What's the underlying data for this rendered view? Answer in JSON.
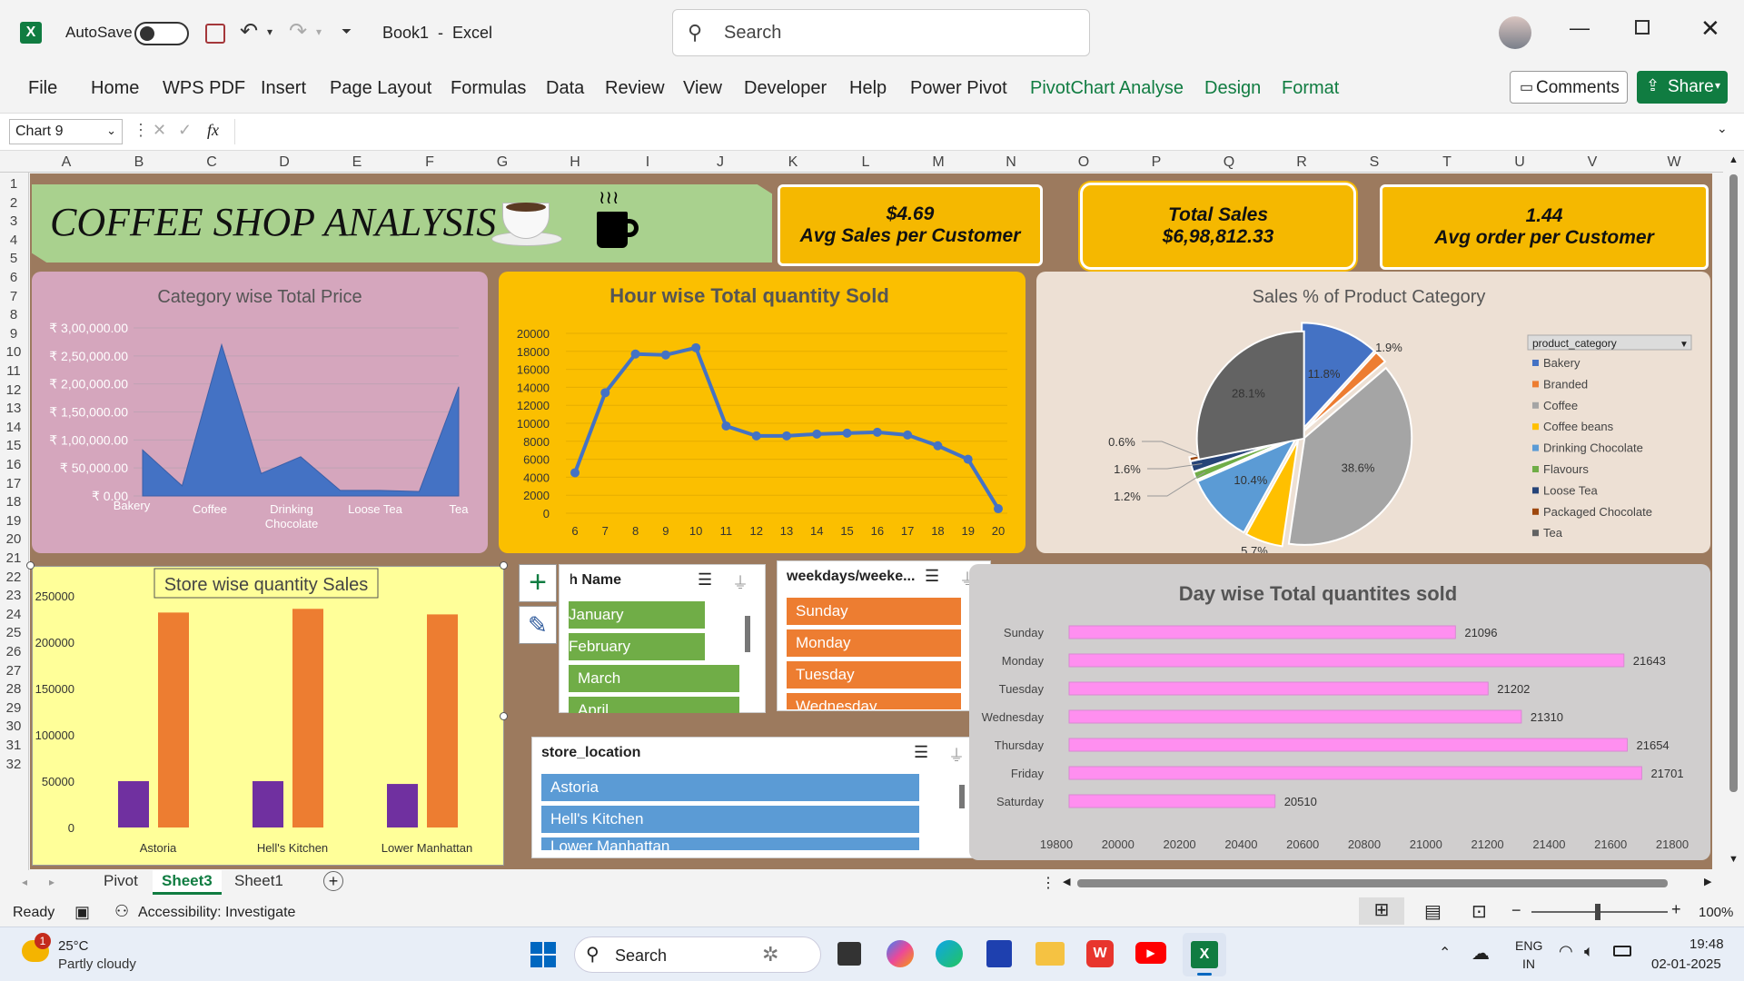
{
  "titlebar": {
    "autosave_label": "AutoSave",
    "doc_title": "Book1  -  Excel",
    "search_placeholder": "Search"
  },
  "ribbon": {
    "tabs": [
      "File",
      "Home",
      "WPS PDF",
      "Insert",
      "Page Layout",
      "Formulas",
      "Data",
      "Review",
      "View",
      "Developer",
      "Help",
      "Power Pivot",
      "PivotChart Analyse",
      "Design",
      "Format"
    ],
    "comments_label": "Comments",
    "share_label": "Share"
  },
  "formula_bar": {
    "name_box": "Chart 9",
    "fx": "fx"
  },
  "columns": [
    "A",
    "B",
    "C",
    "D",
    "E",
    "F",
    "G",
    "H",
    "I",
    "J",
    "K",
    "L",
    "M",
    "N",
    "O",
    "P",
    "Q",
    "R",
    "S",
    "T",
    "U",
    "V",
    "W"
  ],
  "rows": [
    "1",
    "2",
    "3",
    "4",
    "5",
    "6",
    "7",
    "8",
    "9",
    "10",
    "11",
    "12",
    "13",
    "14",
    "15",
    "16",
    "17",
    "18",
    "19",
    "20",
    "21",
    "22",
    "23",
    "24",
    "25",
    "26",
    "27",
    "28",
    "29",
    "30",
    "31",
    "32"
  ],
  "dashboard": {
    "title": "COFFEE SHOP ANALYSIS",
    "kpis": [
      {
        "value": "$4.69",
        "label": "Avg Sales per Customer"
      },
      {
        "value": "Total Sales",
        "label": "$6,98,812.33"
      },
      {
        "value": "1.44",
        "label": "Avg order per Customer"
      }
    ]
  },
  "chart_data": [
    {
      "type": "area",
      "title": "Category wise Total Price",
      "categories": [
        "Bakery",
        "Coffee",
        "Drinking Chocolate",
        "Loose Tea",
        "Tea"
      ],
      "x_tick_labels": [
        "Bakery",
        "Coffee",
        "Drinking",
        "Chocolate",
        "Loose Tea",
        "Tea"
      ],
      "values": [
        82000,
        18000,
        270000,
        40000,
        70000,
        10000,
        10000,
        8000,
        195000
      ],
      "ylim": [
        0,
        300000
      ],
      "y_ticks": [
        "₹ 0.00",
        "₹ 50,000.00",
        "₹ 1,00,000.00",
        "₹ 1,50,000.00",
        "₹ 2,00,000.00",
        "₹ 2,50,000.00",
        "₹ 3,00,000.00"
      ],
      "color": "#4472c4"
    },
    {
      "type": "line",
      "title": "Hour wise Total quantity Sold",
      "x": [
        6,
        7,
        8,
        9,
        10,
        11,
        12,
        13,
        14,
        15,
        16,
        17,
        18,
        19,
        20
      ],
      "values": [
        4500,
        13400,
        17700,
        17600,
        18400,
        9700,
        8600,
        8600,
        8800,
        8900,
        9000,
        8700,
        7500,
        6000,
        500
      ],
      "ylim": [
        0,
        20000
      ],
      "y_ticks": [
        "0",
        "2000",
        "4000",
        "6000",
        "8000",
        "10000",
        "12000",
        "14000",
        "16000",
        "18000",
        "20000"
      ],
      "color": "#4472c4"
    },
    {
      "type": "pie",
      "title": "Sales % of Product Category",
      "legend_title": "product_category",
      "categories": [
        "Bakery",
        "Branded",
        "Coffee",
        "Coffee beans",
        "Drinking Chocolate",
        "Flavours",
        "Loose Tea",
        "Packaged Chocolate",
        "Tea"
      ],
      "values": [
        11.8,
        1.9,
        38.6,
        5.7,
        10.4,
        1.2,
        1.6,
        0.6,
        28.1
      ],
      "labels": [
        "11.8%",
        "1.9%",
        "38.6%",
        "5.7%",
        "10.4%",
        "1.2%",
        "1.6%",
        "0.6%",
        "28.1%"
      ],
      "colors": [
        "#4472c4",
        "#ed7d31",
        "#a5a5a5",
        "#ffc000",
        "#5b9bd5",
        "#70ad47",
        "#264478",
        "#9e480e",
        "#636363"
      ]
    },
    {
      "type": "bar",
      "title": "Store wise quantity Sales",
      "categories": [
        "Astoria",
        "Hell's Kitchen",
        "Lower Manhattan"
      ],
      "series": [
        {
          "values": [
            50000,
            50000,
            47000
          ],
          "color": "#7030a0"
        },
        {
          "values": [
            232000,
            236000,
            230000
          ],
          "color": "#ed7d31"
        }
      ],
      "ylim": [
        0,
        250000
      ],
      "y_ticks": [
        "0",
        "50000",
        "100000",
        "150000",
        "200000",
        "250000"
      ]
    },
    {
      "type": "bar",
      "orientation": "horizontal",
      "title": "Day wise Total quantites sold",
      "categories": [
        "Sunday",
        "Monday",
        "Tuesday",
        "Wednesday",
        "Thursday",
        "Friday",
        "Saturday"
      ],
      "values": [
        21096,
        21643,
        21202,
        21310,
        21654,
        21701,
        20510
      ],
      "xlim": [
        19800,
        21800
      ],
      "x_ticks": [
        "19800",
        "20000",
        "20200",
        "20400",
        "20600",
        "20800",
        "21000",
        "21200",
        "21400",
        "21600",
        "21800"
      ],
      "color": "#ff8ff0"
    }
  ],
  "slicers": {
    "month": {
      "title": "Month Name",
      "items": [
        "January",
        "February",
        "March",
        "April"
      ]
    },
    "weekday": {
      "title": "weekdays/weeke...",
      "items": [
        "Sunday",
        "Monday",
        "Tuesday",
        "Wednesday"
      ]
    },
    "store": {
      "title": "store_location",
      "items": [
        "Astoria",
        "Hell's Kitchen",
        "Lower Manhattan"
      ]
    }
  },
  "sheet_tabs": [
    "Pivot",
    "Sheet3",
    "Sheet1"
  ],
  "status": {
    "ready": "Ready",
    "accessibility": "Accessibility: Investigate",
    "zoom": "100%"
  },
  "taskbar": {
    "temp": "25°C",
    "weather": "Partly cloudy",
    "search": "Search",
    "lang1": "ENG",
    "lang2": "IN",
    "time": "19:48",
    "date": "02-01-2025",
    "badge": "1"
  }
}
